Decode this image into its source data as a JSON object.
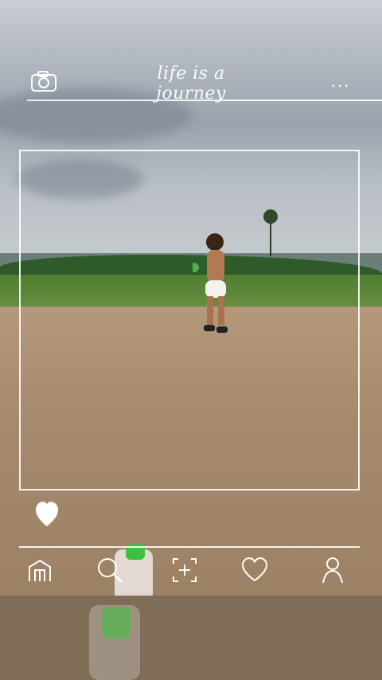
{
  "header": {
    "title": "life is a journey",
    "more_label": "...",
    "camera_icon": "camera-icon"
  },
  "badge": {
    "icon": "heart-filled-icon"
  },
  "nav": {
    "items": [
      {
        "name": "home",
        "icon": "home-icon"
      },
      {
        "name": "search",
        "icon": "search-icon"
      },
      {
        "name": "add",
        "icon": "add-frame-icon"
      },
      {
        "name": "favorites",
        "icon": "heart-icon"
      },
      {
        "name": "profile",
        "icon": "person-icon"
      }
    ]
  },
  "colors": {
    "ui": "#ffffff",
    "bottle_cap": "#3fbf3f"
  }
}
